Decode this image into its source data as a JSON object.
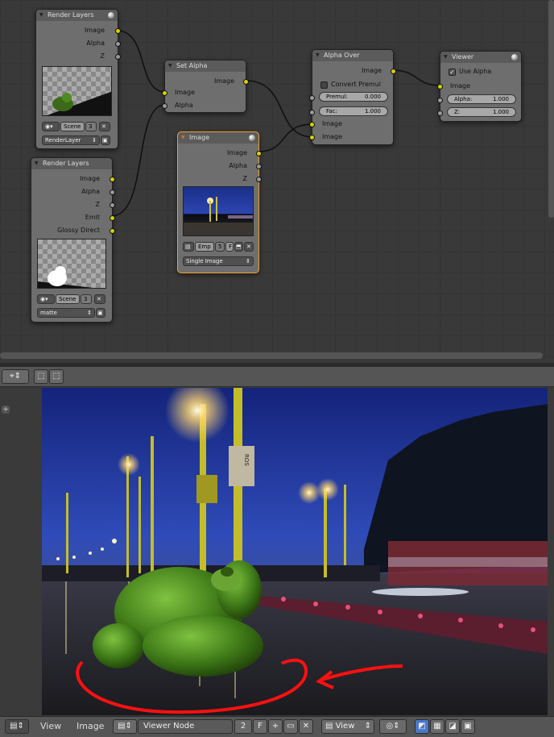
{
  "nodes": {
    "render_layers_1": {
      "title": "Render Layers",
      "outputs": [
        "Image",
        "Alpha",
        "Z"
      ],
      "scene_label": "Scene",
      "scene_users": "3",
      "layer_select": "RenderLayer"
    },
    "render_layers_2": {
      "title": "Render Layers",
      "outputs": [
        "Image",
        "Alpha",
        "Z",
        "Emit",
        "Glossy Direct"
      ],
      "scene_label": "Scene",
      "scene_users": "3",
      "layer_select": "matte"
    },
    "set_alpha": {
      "title": "Set Alpha",
      "output": "Image",
      "inputs": [
        "Image",
        "Alpha"
      ]
    },
    "image": {
      "title": "Image",
      "outputs": [
        "Image",
        "Alpha",
        "Z"
      ],
      "image_name": "Emp",
      "image_users": "5",
      "fake_user": "F",
      "source_select": "Single Image"
    },
    "alpha_over": {
      "title": "Alpha Over",
      "output": "Image",
      "convert_premul_label": "Convert Premul",
      "premul_label": "Premul:",
      "premul_value": "0.000",
      "fac_label": "Fac:",
      "fac_value": "1.000",
      "inputs": [
        "Image",
        "Image"
      ]
    },
    "viewer": {
      "title": "Viewer",
      "use_alpha_label": "Use Alpha",
      "input": "Image",
      "alpha_label": "Alpha:",
      "alpha_value": "1.000",
      "z_label": "Z:",
      "z_value": "1.000"
    }
  },
  "image_editor": {
    "footer": {
      "view_menu": "View",
      "image_menu": "Image",
      "image_name": "Viewer Node",
      "users": "2",
      "fake_user": "F",
      "display_select": "View"
    },
    "street_sign": "ROS"
  },
  "colors": {
    "socket_color": "#d8d000",
    "data_socket": "#9a9a9a",
    "selected_outline": "#f0a030",
    "annotation": "#ff1010"
  }
}
